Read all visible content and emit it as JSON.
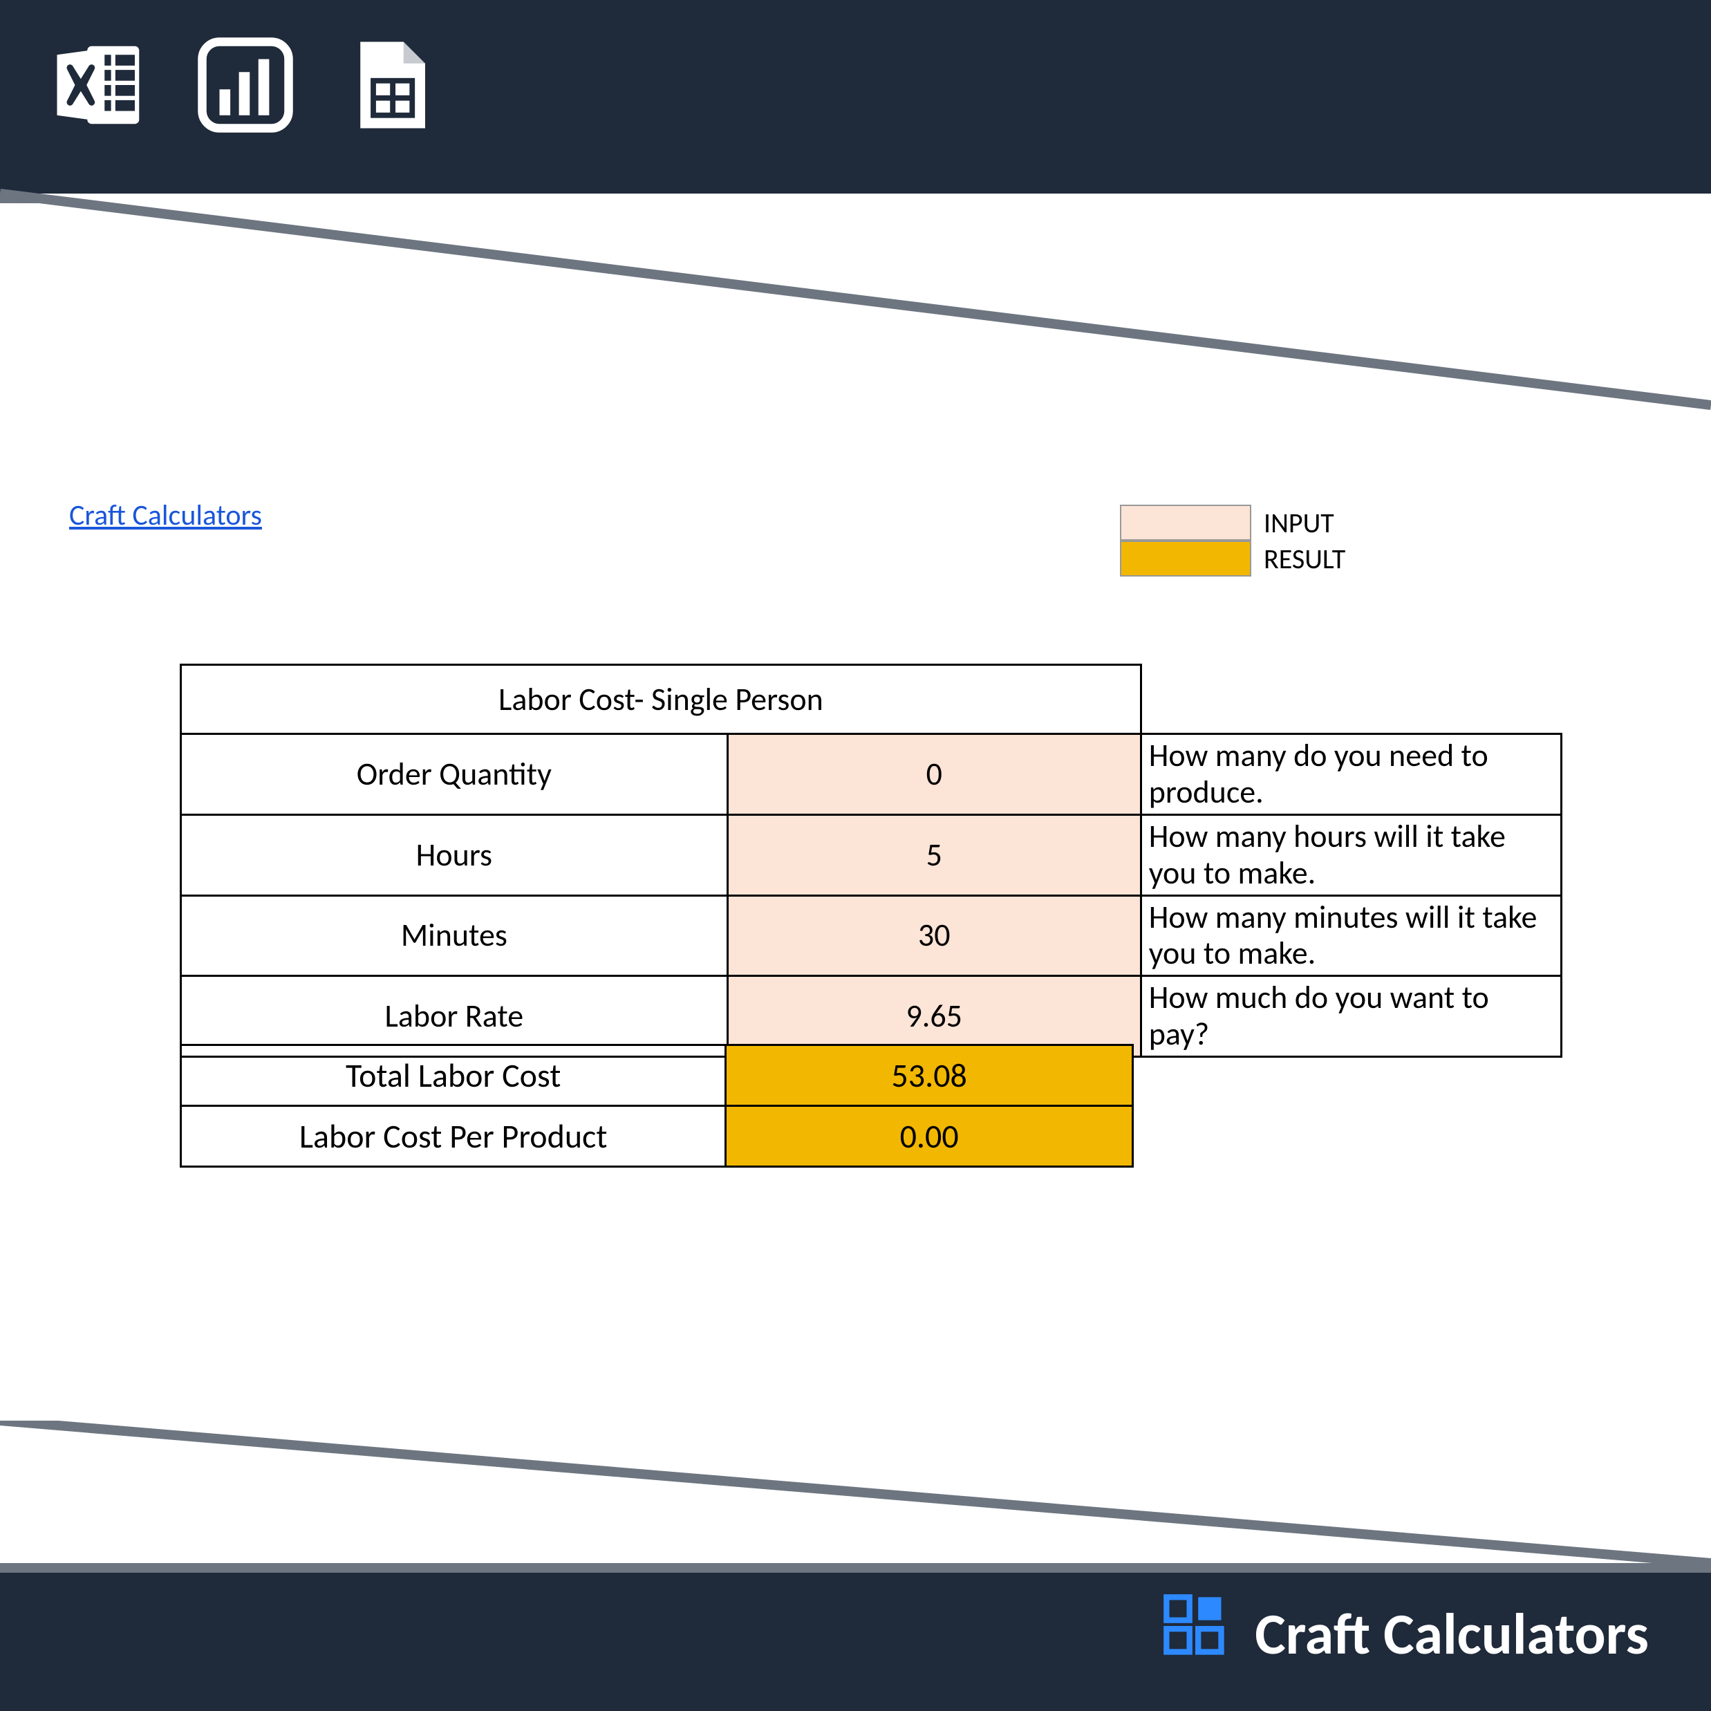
{
  "colors": {
    "banner": "#1f2a3a",
    "accent": "#6d7580",
    "input_bg": "#fce4d6",
    "result_bg": "#f2b700",
    "link": "#1a56db",
    "brand_blue": "#2d89ff"
  },
  "header_icons": [
    "excel-icon",
    "chart-icon",
    "sheets-icon"
  ],
  "link_text": "Craft Calculators",
  "legend": {
    "input_label": "INPUT",
    "result_label": "RESULT"
  },
  "table": {
    "title": "Labor Cost- Single Person",
    "rows": [
      {
        "label": "Order Quantity",
        "value": "0",
        "note": "How many do you need to produce."
      },
      {
        "label": "Hours",
        "value": "5",
        "note": "How many hours will it take you to make."
      },
      {
        "label": "Minutes",
        "value": "30",
        "note": "How many minutes will it take you to make."
      },
      {
        "label": "Labor Rate",
        "value": "9.65",
        "note": "How much do you want to pay?"
      }
    ]
  },
  "results": [
    {
      "label": "Total Labor Cost",
      "value": "53.08"
    },
    {
      "label": "Labor Cost Per Product",
      "value": "0.00"
    }
  ],
  "footer_brand": "Craft Calculators"
}
